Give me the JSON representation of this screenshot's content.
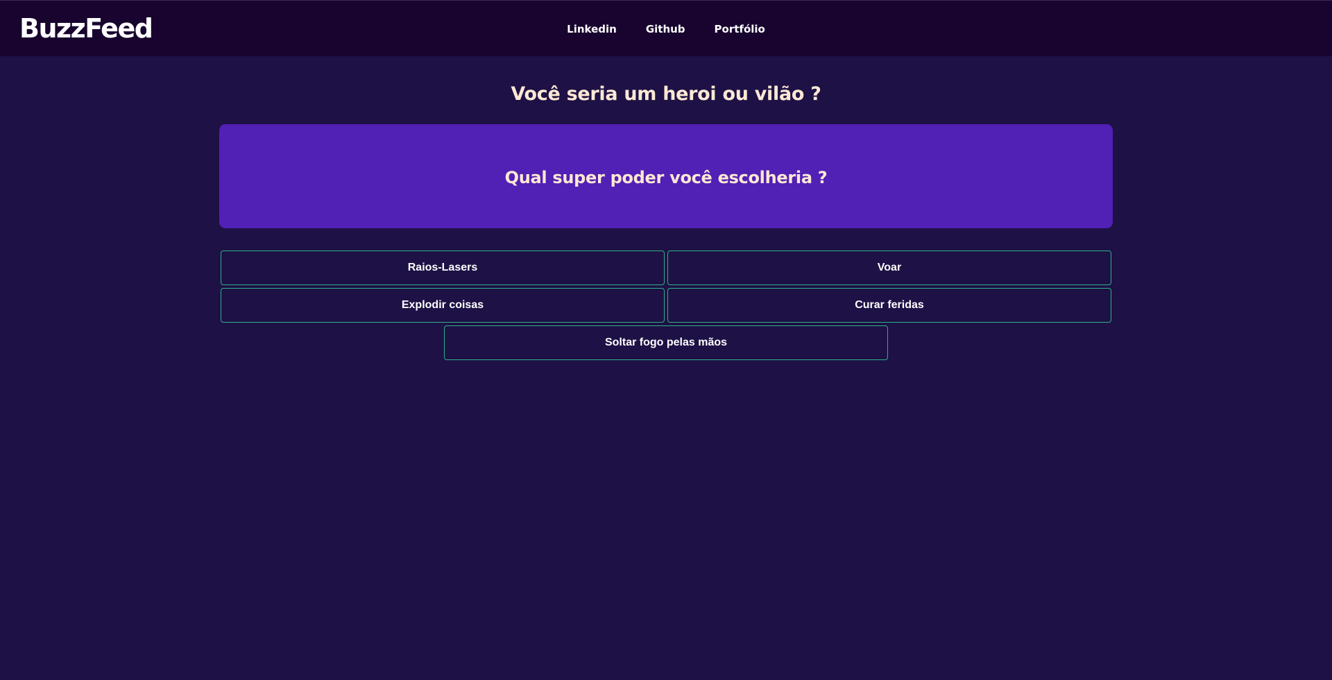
{
  "header": {
    "logo": "BuzzFeed",
    "nav": [
      {
        "label": "Linkedin"
      },
      {
        "label": "Github"
      },
      {
        "label": "Portfólio"
      }
    ]
  },
  "quiz": {
    "title": "Você seria um heroi ou vilão ?",
    "question": "Qual super poder você escolheria ?",
    "options": [
      {
        "label": "Raios-Lasers"
      },
      {
        "label": "Voar"
      },
      {
        "label": "Explodir coisas"
      },
      {
        "label": "Curar feridas"
      },
      {
        "label": "Soltar fogo pelas mãos"
      }
    ]
  },
  "colors": {
    "page_background": "#1d1145",
    "header_background": "#18042e",
    "question_card": "#5120b5",
    "title_text": "#fde8d4",
    "option_border": "#2fb38a"
  }
}
